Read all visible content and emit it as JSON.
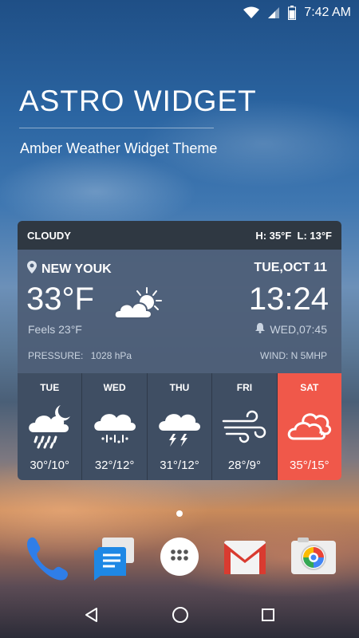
{
  "status_bar": {
    "time": "7:42 AM"
  },
  "hero": {
    "title": "ASTRO WIDGET",
    "subtitle": "Amber Weather Widget Theme"
  },
  "widget": {
    "condition": "CLOUDY",
    "high": "H: 35°F",
    "low": "L: 13°F",
    "location": "NEW YOUK",
    "date": "TUE,OCT 11",
    "temperature": "33°F",
    "time": "13:24",
    "feels_like": "Feels 23°F",
    "alarm": "WED,07:45",
    "pressure_label": "PRESSURE:",
    "pressure_value": "1028 hPa",
    "wind": "WIND: N 5MHP",
    "forecast": [
      {
        "day": "TUE",
        "range": "30°/10°",
        "icon": "night-rain-icon"
      },
      {
        "day": "WED",
        "range": "32°/12°",
        "icon": "snow-cloud-icon"
      },
      {
        "day": "THU",
        "range": "31°/12°",
        "icon": "thunderstorm-icon"
      },
      {
        "day": "FRI",
        "range": "28°/9°",
        "icon": "wind-icon"
      },
      {
        "day": "SAT",
        "range": "35°/15°",
        "icon": "cloudy-icon"
      }
    ],
    "colors": {
      "active_day": "#f0584a",
      "panel": "#3f4e63",
      "header": "#2f3842"
    }
  },
  "dock": {
    "apps": [
      {
        "icon": "phone-icon"
      },
      {
        "icon": "messages-icon"
      },
      {
        "icon": "app-drawer-icon"
      },
      {
        "icon": "gmail-icon"
      },
      {
        "icon": "camera-icon"
      }
    ]
  },
  "nav": {
    "buttons": [
      "back-icon",
      "home-icon",
      "recents-icon"
    ]
  }
}
